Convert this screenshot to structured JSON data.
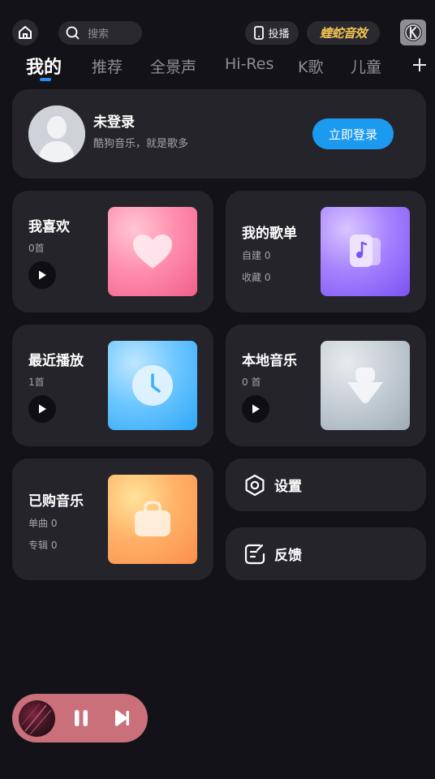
{
  "header": {
    "search_placeholder": "搜索",
    "cast_label": "投播",
    "brand_label": "蝰蛇音效",
    "icons": [
      "home-icon",
      "search-icon",
      "phone-cast-icon",
      "kugou-logo"
    ]
  },
  "tabs": [
    {
      "label": "我的",
      "active": true
    },
    {
      "label": "推荐",
      "active": false
    },
    {
      "label": "全景声",
      "active": false
    },
    {
      "label": "Hi-Res",
      "active": false
    },
    {
      "label": "K歌",
      "active": false
    },
    {
      "label": "儿童",
      "active": false
    }
  ],
  "profile": {
    "name": "未登录",
    "slogan": "酷狗音乐，就是歌多",
    "login_label": "立即登录"
  },
  "tiles": {
    "favorites": {
      "title": "我喜欢",
      "line1": "0首"
    },
    "playlists": {
      "title": "我的歌单",
      "line1": "自建 0",
      "line2": "收藏 0"
    },
    "recent": {
      "title": "最近播放",
      "line1": "1首"
    },
    "local": {
      "title": "本地音乐",
      "line1": "0 首"
    },
    "purchased": {
      "title": "已购音乐",
      "line1": "单曲 0",
      "line2": "专辑 0"
    }
  },
  "settings_label": "设置",
  "feedback_label": "反馈",
  "colors": {
    "background": "#131218",
    "card": "#25242b",
    "accent": "#1c9af0",
    "mini_player": "#c9707b"
  }
}
